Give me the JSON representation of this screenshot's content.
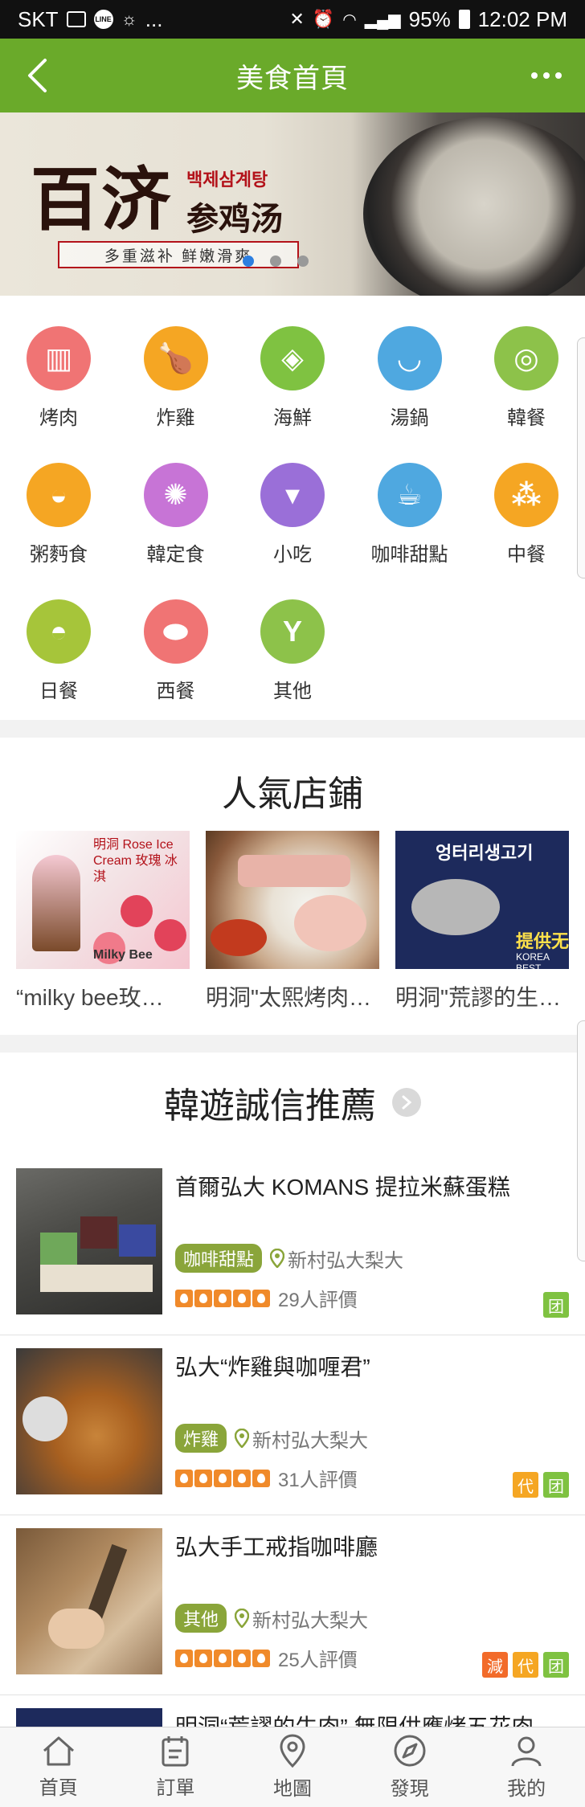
{
  "status_bar": {
    "carrier": "SKT",
    "battery": "95%",
    "time": "12:02 PM",
    "dots": "..."
  },
  "app_bar": {
    "title": "美食首頁"
  },
  "banner": {
    "title": "百济",
    "korean": "백제삼계탕",
    "chinese": "参鸡汤",
    "tagline": "多重滋补 鲜嫩滑爽",
    "pages": 3,
    "active_page": 1
  },
  "categories": [
    {
      "label": "烤肉",
      "color": "#f07474",
      "icon": "grill-icon"
    },
    {
      "label": "炸雞",
      "color": "#f5a623",
      "icon": "drumstick-icon"
    },
    {
      "label": "海鮮",
      "color": "#7fc241",
      "icon": "fish-icon"
    },
    {
      "label": "湯鍋",
      "color": "#4fa8e0",
      "icon": "soup-bowl-icon"
    },
    {
      "label": "韓餐",
      "color": "#8dc24a",
      "icon": "plate-icon"
    },
    {
      "label": "粥麪食",
      "color": "#f5a623",
      "icon": "noodle-bowl-icon"
    },
    {
      "label": "韓定食",
      "color": "#c774d6",
      "icon": "table-setting-icon"
    },
    {
      "label": "小吃",
      "color": "#9a6fd8",
      "icon": "ice-cream-icon"
    },
    {
      "label": "咖啡甜點",
      "color": "#4fa8e0",
      "icon": "coffee-cup-icon"
    },
    {
      "label": "中餐",
      "color": "#f5a623",
      "icon": "dumplings-icon"
    },
    {
      "label": "日餐",
      "color": "#a6c53a",
      "icon": "sushi-icon"
    },
    {
      "label": "西餐",
      "color": "#f07474",
      "icon": "sausage-icon"
    },
    {
      "label": "其他",
      "color": "#8dc24a",
      "icon": "cocktail-icon"
    }
  ],
  "popular": {
    "title": "人氣店鋪",
    "shops": [
      {
        "name": "“milky bee玫…",
        "img_text": "明洞 Rose Ice Cream 玫瑰 冰淇",
        "img_brand": "Milky Bee"
      },
      {
        "name": "明洞\"太熙烤肉…"
      },
      {
        "name": "明洞\"荒謬的生…",
        "img_text": "엉터리생고기",
        "img_sub": "提供无",
        "img_brand": "KOREA BEST"
      }
    ]
  },
  "recommend": {
    "title": "韓遊誠信推薦",
    "items": [
      {
        "name": "首爾弘大 KOMANS 提拉米蘇蛋糕",
        "tag": "咖啡甜點",
        "location": "新村弘大梨大",
        "reviews": "29人評價",
        "badges": [
          {
            "text": "团",
            "color": "#7fc241"
          }
        ]
      },
      {
        "name": "弘大“炸雞與咖喱君”",
        "tag": "炸雞",
        "location": "新村弘大梨大",
        "reviews": "31人評價",
        "badges": [
          {
            "text": "代",
            "color": "#f5a623"
          },
          {
            "text": "团",
            "color": "#7fc241"
          }
        ]
      },
      {
        "name": "弘大手工戒指咖啡廳",
        "tag": "其他",
        "location": "新村弘大梨大",
        "reviews": "25人評價",
        "badges": [
          {
            "text": "減",
            "color": "#f26b2a"
          },
          {
            "text": "代",
            "color": "#f5a623"
          },
          {
            "text": "团",
            "color": "#7fc241"
          }
        ]
      },
      {
        "name": "明洞“荒謬的牛肉” 無限供應烤五花肉"
      }
    ],
    "rating_flames": 5
  },
  "bottom_nav": [
    {
      "label": "首頁",
      "icon": "home-icon"
    },
    {
      "label": "訂單",
      "icon": "order-list-icon"
    },
    {
      "label": "地圖",
      "icon": "map-pin-icon"
    },
    {
      "label": "發現",
      "icon": "compass-icon"
    },
    {
      "label": "我的",
      "icon": "user-icon"
    }
  ]
}
